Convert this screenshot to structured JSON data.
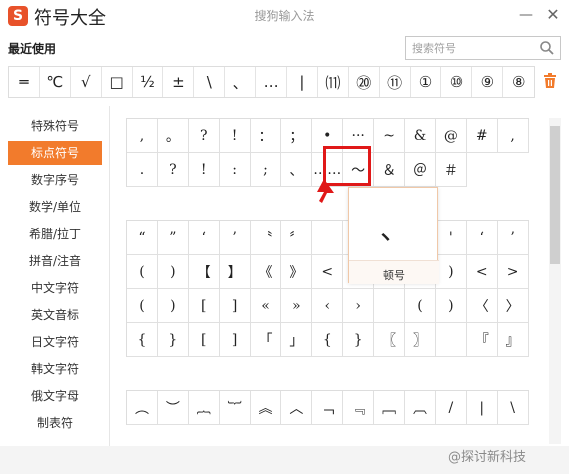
{
  "app": {
    "logo": "S",
    "title": "符号大全",
    "window_title": "搜狗输入法"
  },
  "window": {
    "min": "—",
    "close": "✕"
  },
  "recent": {
    "label": "最近使用",
    "search_placeholder": "搜索符号",
    "symbols": [
      "═",
      "℃",
      "√",
      "□",
      "½",
      "±",
      "\\",
      "、",
      "…",
      "|",
      "⑾",
      "⑳",
      "⑪",
      "①",
      "⑩",
      "⑨",
      "⑧"
    ]
  },
  "categories": [
    "特殊符号",
    "标点符号",
    "数字序号",
    "数学/单位",
    "希腊/拉丁",
    "拼音/注音",
    "中文字符",
    "英文音标",
    "日文字符",
    "韩文字符",
    "俄文字母",
    "制表符"
  ],
  "active_category": "标点符号",
  "grid1": [
    ",",
    "。",
    "?",
    "!",
    "：",
    "；",
    "•",
    "···",
    "~",
    "&",
    "@",
    "#",
    ",",
    ".",
    "?",
    "!",
    ":",
    ";",
    "、",
    "……",
    "～",
    "＆",
    "＠",
    "＃"
  ],
  "grid2": [
    "“",
    "”",
    "‘",
    "’",
    "〝",
    "〞",
    "",
    "",
    "",
    "",
    "'",
    "‘",
    "’",
    "(",
    ")",
    "【",
    "】",
    "《",
    "》",
    "<",
    "",
    "",
    "",
    ")",
    "<",
    ">",
    "(",
    ")",
    "[",
    "]",
    "«",
    "»",
    "‹",
    "›",
    "",
    "(",
    ")",
    "〈",
    "〉",
    "{",
    "}",
    "[",
    "]",
    "「",
    "」",
    "{",
    "}",
    "〖",
    "〗",
    "",
    "『",
    "』"
  ],
  "grid3": [
    "︵",
    "︶",
    "︷",
    "︸",
    "︽",
    "︿",
    "﹁",
    "﹃",
    "﹇",
    "︹",
    "/",
    "|",
    "\\"
  ],
  "tooltip": {
    "char": "、",
    "name": "顿号"
  },
  "watermark": "@探讨新科技",
  "colors": {
    "accent": "#f27b2c",
    "highlight": "#e01818",
    "logo": "#e8522a"
  }
}
